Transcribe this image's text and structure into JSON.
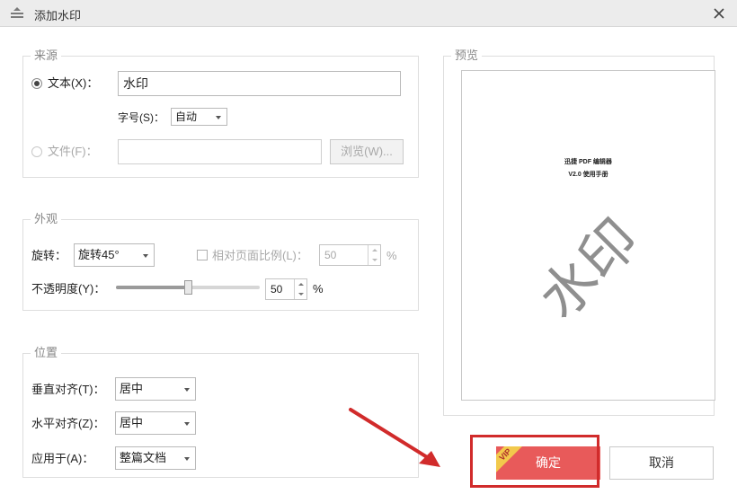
{
  "window": {
    "title": "添加水印"
  },
  "source": {
    "legend": "来源",
    "text_label": "文本(X)：",
    "text_value": "水印",
    "fontsize_label": "字号(S)：",
    "fontsize_value": "自动",
    "file_label": "文件(F)：",
    "file_value": "",
    "browse_label": "浏览(W)..."
  },
  "appearance": {
    "legend": "外观",
    "rotation_label": "旋转：",
    "rotation_value": "旋转45°",
    "relative_label": "相对页面比例(L)：",
    "relative_value": "50",
    "relative_unit": "%",
    "opacity_label": "不透明度(Y)：",
    "opacity_value": "50",
    "opacity_unit": "%",
    "opacity_level": 50
  },
  "position": {
    "legend": "位置",
    "vertical_label": "垂直对齐(T)：",
    "vertical_value": "居中",
    "horizontal_label": "水平对齐(Z)：",
    "horizontal_value": "居中",
    "apply_label": "应用于(A)：",
    "apply_value": "整篇文档"
  },
  "preview": {
    "legend": "预览",
    "doc_title": "迅捷 PDF 编辑器",
    "doc_subtitle": "V2.0 使用手册",
    "watermark_text": "水印"
  },
  "buttons": {
    "ok_label": "确定",
    "cancel_label": "取消",
    "vip_badge": "VIP"
  },
  "colors": {
    "ok_button": "#e85a5a",
    "highlight": "#d12b2b",
    "vip_badge": "#f2c94c"
  }
}
